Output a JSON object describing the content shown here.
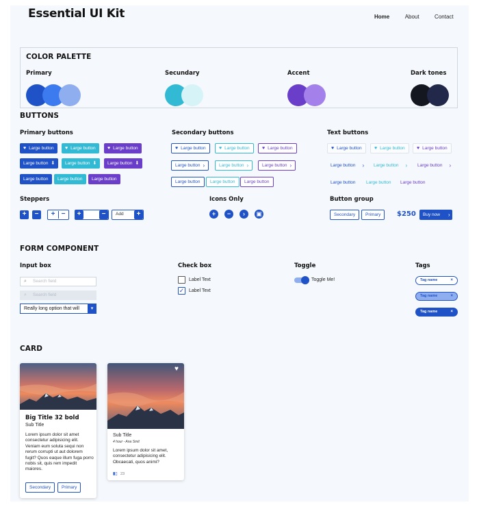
{
  "header": {
    "brand": "Essential UI Kit",
    "nav": [
      "Home",
      "About",
      "Contact"
    ]
  },
  "palette": {
    "title": "COLOR PALETTE",
    "groups": [
      {
        "label": "Primary",
        "colors": [
          "#1f51c7",
          "#3b7bef",
          "#8faef0"
        ]
      },
      {
        "label": "Secundary",
        "colors": [
          "#32b9d4",
          "#d6f3f8"
        ]
      },
      {
        "label": "Accent",
        "colors": [
          "#6a3ec9",
          "#a480ea"
        ]
      },
      {
        "label": "Dark tones",
        "colors": [
          "#14171f",
          "#22284a"
        ]
      }
    ]
  },
  "buttons": {
    "title": "BUTTONS",
    "primary_title": "Primary buttons",
    "secondary_title": "Secondary buttons",
    "text_title": "Text buttons",
    "label": "Large button",
    "steppers_title": "Steppers",
    "icons_title": "Icons Only",
    "group_title": "Button group",
    "stepper_add": "Add",
    "group": {
      "secondary": "Secondary",
      "primary": "Primary",
      "price": "$250",
      "buy": "Buy now"
    }
  },
  "form": {
    "title": "FORM COMPONENT",
    "input_title": "Input box",
    "checkbox_title": "Check box",
    "toggle_title": "Toggle",
    "tags_title": "Tags",
    "search_placeholder": "Search field",
    "select_value": "Really long option that will",
    "checkbox_label": "Label Text",
    "toggle_label": "Toggle Me!",
    "tag_label": "Tag name"
  },
  "card": {
    "title": "CARD",
    "card1": {
      "title": "Big Title 32 bold",
      "subtitle": "Sub Title",
      "body": "Lorem ipsum dolor sit amet consectetur adipisicing elit. Veniam eum soluta sequi non rerum corrupti ut aut dolorem fugit? Quos eaque illum fuga porro nobis sit, quis rem impedit maiores.",
      "secondary": "Secondary",
      "primary": "Primary"
    },
    "card2": {
      "subtitle": "Sub Title",
      "meta": "4 hour - Ana Smit",
      "body": "Lorem ipsum dolor sit amet, consectetur adipisicing elit. Obcaecati, quos animi?",
      "likes": "23"
    }
  }
}
